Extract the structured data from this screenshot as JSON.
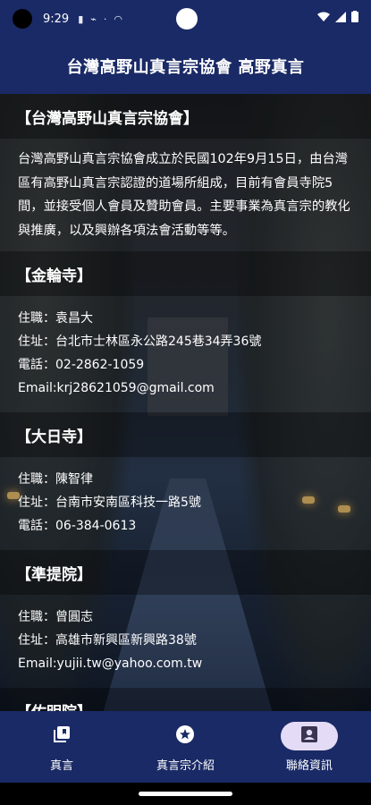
{
  "status_bar": {
    "time": "9:29"
  },
  "app_bar": {
    "title": "台灣高野山真言宗協會 高野真言"
  },
  "association": {
    "heading": "【台灣高野山真言宗協會】",
    "body": "台灣高野山真言宗協會成立於民國102年9月15日，由台灣區有高野山真言宗認證的道場所組成，目前有會員寺院5間，並接受個人會員及贊助會員。主要事業為真言宗的教化與推廣，以及興辦各項法會活動等等。"
  },
  "temples": [
    {
      "heading": "【金輪寺】",
      "lines": [
        "住職：袁昌大",
        "住址：台北市士林區永公路245巷34弄36號",
        "電話：02-2862-1059",
        "Email:krj28621059@gmail.com"
      ]
    },
    {
      "heading": "【大日寺】",
      "lines": [
        "住職：陳智律",
        "住址：台南市安南區科技一路5號",
        "電話：06-384-0613"
      ]
    },
    {
      "heading": "【準提院】",
      "lines": [
        "住職：曾圓志",
        "住址：高雄市新興區新興路38號",
        "Email:yujii.tw@yahoo.com.tw"
      ]
    },
    {
      "heading": "【佑明院】",
      "lines": []
    }
  ],
  "bottom_nav": {
    "items": [
      {
        "label": "真言",
        "icon": "book-stack-icon",
        "active": false
      },
      {
        "label": "真言宗介紹",
        "icon": "star-circle-icon",
        "active": false
      },
      {
        "label": "聯絡資訊",
        "icon": "person-icon",
        "active": true
      }
    ]
  },
  "colors": {
    "bar": "#1a2a66",
    "active_pill": "#e4dcf7"
  }
}
